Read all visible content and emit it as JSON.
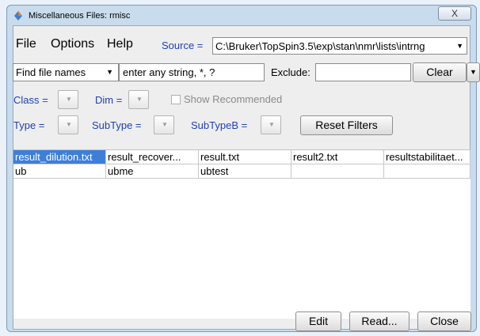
{
  "window": {
    "title": "Miscellaneous Files: rmisc",
    "close_glyph": "X"
  },
  "menu": {
    "file": "File",
    "options": "Options",
    "help": "Help"
  },
  "source": {
    "label": "Source =",
    "value": "C:\\Bruker\\TopSpin3.5\\exp\\stan\\nmr\\lists\\intrng"
  },
  "search": {
    "mode": "Find file names",
    "query": "enter any string, *, ?",
    "exclude_label": "Exclude:",
    "exclude_value": "",
    "clear": "Clear"
  },
  "filters": {
    "class_label": "Class =",
    "dim_label": "Dim =",
    "show_recommended": "Show Recommended",
    "type_label": "Type =",
    "subtype_label": "SubType =",
    "subtypeb_label": "SubTypeB =",
    "reset": "Reset Filters"
  },
  "files": {
    "row1": [
      "result_dilution.txt",
      "result_recover...",
      "result.txt",
      "result2.txt",
      "resultstabilitaet..."
    ],
    "row2": [
      "ub",
      "ubme",
      "ubtest",
      "",
      ""
    ]
  },
  "buttons": {
    "edit": "Edit",
    "read": "Read...",
    "close": "Close"
  },
  "colors": {
    "label_blue": "#1f3fb6",
    "selection": "#3d7fd8"
  },
  "icons": {
    "app": "bruker-diamond-icon"
  }
}
